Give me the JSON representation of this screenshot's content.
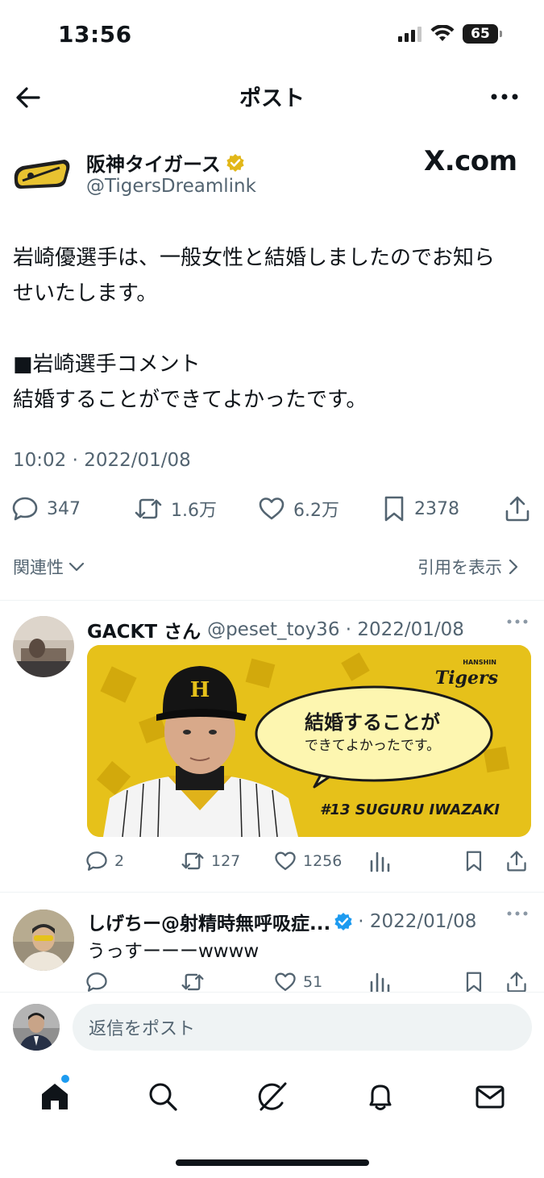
{
  "status_bar": {
    "time": "13:56",
    "battery": "65"
  },
  "header": {
    "title": "ポスト"
  },
  "post": {
    "author_name": "阪神タイガース",
    "author_handle": "@TigersDreamlink",
    "watermark": "X.com",
    "text": "岩崎優選手は、一般女性と結婚しましたのでお知ら\nせいたします。\n\n■岩崎選手コメント\n結婚することができてよかったです。",
    "timestamp": "10:02 · 2022/01/08",
    "stats": {
      "replies": "347",
      "reposts": "1.6万",
      "likes": "6.2万",
      "bookmarks": "2378"
    }
  },
  "sort": {
    "relevance_label": "関連性",
    "quotes_label": "引用を表示"
  },
  "replies": [
    {
      "name": "GACKT さん",
      "handle_date": "@peset_toy36 · 2022/01/08",
      "image": {
        "logo_small": "HANSHIN",
        "logo": "Tigers",
        "bubble_line1": "結婚することが",
        "bubble_line2": "できてよかったです。",
        "caption": "#13 SUGURU IWAZAKI"
      },
      "stats": {
        "replies": "2",
        "reposts": "127",
        "likes": "1256"
      }
    },
    {
      "name": "しげちー@射精時無呼吸症...",
      "date": "· 2022/01/08",
      "text": "うっすーーーwwww",
      "stats": {
        "likes": "51"
      }
    }
  ],
  "composer": {
    "placeholder": "返信をポスト"
  },
  "colors": {
    "accent": "#1d9bf0",
    "muted": "#536471",
    "verified_gold": "#e2b719"
  },
  "icons": [
    "back-arrow-icon",
    "more-icon",
    "reply-icon",
    "repost-icon",
    "like-icon",
    "bookmark-icon",
    "share-icon",
    "views-icon",
    "home-icon",
    "search-icon",
    "grok-icon",
    "bell-icon",
    "mail-icon"
  ]
}
